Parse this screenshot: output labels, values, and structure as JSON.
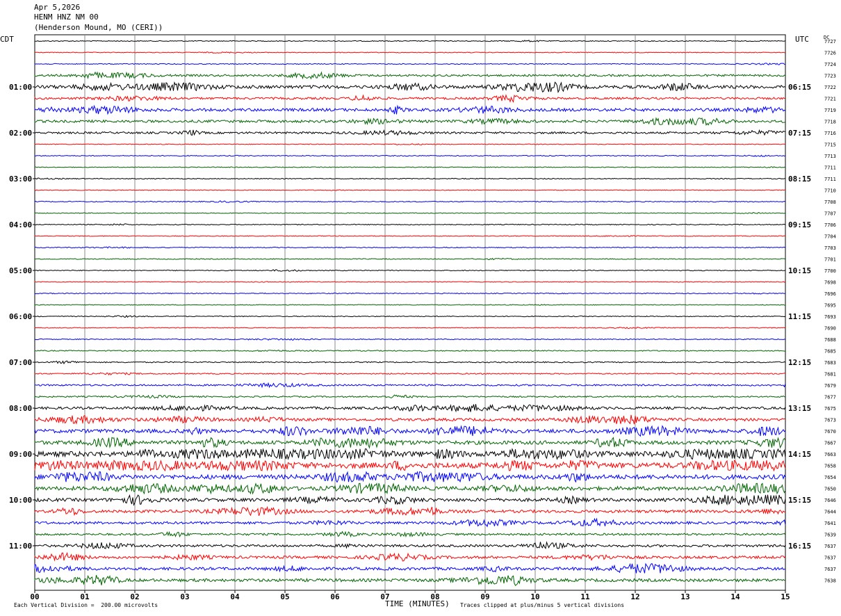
{
  "header": {
    "date": "Apr 5,2026",
    "station": "HENM HNZ NM 00",
    "location": "(Henderson Mound, MO (CERI))"
  },
  "tz_left": "CDT",
  "tz_right": "UTC",
  "dc_label": "DC",
  "footer": {
    "division_note": "Each Vertical Division =  200.00 microvolts",
    "clip_note": "Traces clipped at plus/minus 5 vertical divisions"
  },
  "colors": {
    "trace_cycle": [
      "#000000",
      "#ff0000",
      "#0000ff",
      "#006400"
    ],
    "grid": "#8a8a8a"
  },
  "chart_data": {
    "type": "line",
    "xlabel": "TIME (MINUTES)",
    "xlim": [
      0,
      15
    ],
    "x_ticks": [
      "00",
      "01",
      "02",
      "03",
      "04",
      "05",
      "06",
      "07",
      "08",
      "09",
      "10",
      "11",
      "12",
      "13",
      "14",
      "15"
    ],
    "left_time_labels": [
      {
        "row": 4,
        "label": "01:00"
      },
      {
        "row": 8,
        "label": "02:00"
      },
      {
        "row": 12,
        "label": "03:00"
      },
      {
        "row": 16,
        "label": "04:00"
      },
      {
        "row": 20,
        "label": "05:00"
      },
      {
        "row": 24,
        "label": "06:00"
      },
      {
        "row": 28,
        "label": "07:00"
      },
      {
        "row": 32,
        "label": "08:00"
      },
      {
        "row": 36,
        "label": "09:00"
      },
      {
        "row": 40,
        "label": "10:00"
      },
      {
        "row": 44,
        "label": "11:00"
      }
    ],
    "right_time_labels": [
      {
        "row": 4,
        "label": "06:15"
      },
      {
        "row": 8,
        "label": "07:15"
      },
      {
        "row": 12,
        "label": "08:15"
      },
      {
        "row": 16,
        "label": "09:15"
      },
      {
        "row": 20,
        "label": "10:15"
      },
      {
        "row": 24,
        "label": "11:15"
      },
      {
        "row": 28,
        "label": "12:15"
      },
      {
        "row": 32,
        "label": "13:15"
      },
      {
        "row": 36,
        "label": "14:15"
      },
      {
        "row": 40,
        "label": "15:15"
      },
      {
        "row": 44,
        "label": "16:15"
      }
    ],
    "dc_offsets": [
      "7727",
      "7726",
      "7724",
      "7723",
      "7722",
      "7721",
      "7719",
      "7718",
      "7716",
      "7715",
      "7713",
      "7711",
      "7711",
      "7710",
      "7708",
      "7707",
      "7706",
      "7704",
      "7703",
      "7701",
      "7700",
      "7698",
      "7696",
      "7695",
      "7693",
      "7690",
      "7688",
      "7685",
      "7683",
      "7681",
      "7679",
      "7677",
      "7675",
      "7673",
      "7670",
      "7667",
      "7663",
      "7658",
      "7654",
      "7650",
      "7646",
      "7644",
      "7641",
      "7639",
      "7637",
      "7637",
      "7637",
      "7638"
    ],
    "trace_activity": [
      0.3,
      0.2,
      0.3,
      1.2,
      2.2,
      1.3,
      2.0,
      1.6,
      1.2,
      0.2,
      0.3,
      0.2,
      0.3,
      0.2,
      0.3,
      0.2,
      0.3,
      0.2,
      0.3,
      0.3,
      0.3,
      0.2,
      0.3,
      0.2,
      0.3,
      0.2,
      0.3,
      0.4,
      0.5,
      0.5,
      0.9,
      0.7,
      1.6,
      1.8,
      2.6,
      2.6,
      3.8,
      4.0,
      3.2,
      2.6,
      2.2,
      1.8,
      1.6,
      1.2,
      1.5,
      1.7,
      1.9,
      2.0
    ]
  }
}
